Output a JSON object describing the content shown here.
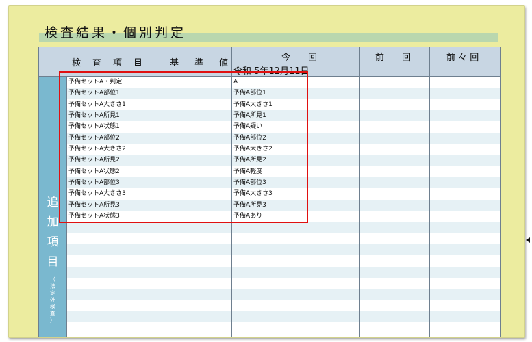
{
  "page": {
    "title": "検査結果・個別判定",
    "side_label_main": [
      "追",
      "加",
      "項",
      "目"
    ],
    "side_label_sub": [
      "（",
      "法",
      "定",
      "外",
      "検",
      "査",
      "）"
    ]
  },
  "table": {
    "headers": {
      "item": "検　査　項　目",
      "standard": [
        "基",
        "準",
        "値"
      ],
      "current": "今　　回",
      "current_date": "令和 5年12月11日",
      "previous": "前　　回",
      "previous2": "前 々 回"
    },
    "rows": [
      {
        "item": "予備セットA・判定",
        "current": "A"
      },
      {
        "item": "予備セットA部位1",
        "current": "予備A部位1"
      },
      {
        "item": "予備セットA大きさ1",
        "current": "予備A大きさ1"
      },
      {
        "item": "予備セットA所見1",
        "current": "予備A所見1"
      },
      {
        "item": "予備セットA状態1",
        "current": "予備A疑い"
      },
      {
        "item": "予備セットA部位2",
        "current": "予備A部位2"
      },
      {
        "item": "予備セットA大きさ2",
        "current": "予備A大きさ2"
      },
      {
        "item": "予備セットA所見2",
        "current": "予備A所見2"
      },
      {
        "item": "予備セットA状態2",
        "current": "予備A軽度"
      },
      {
        "item": "予備セットA部位3",
        "current": "予備A部位3"
      },
      {
        "item": "予備セットA大きさ3",
        "current": "予備A大きさ3"
      },
      {
        "item": "予備セットA所見3",
        "current": "予備A所見3"
      },
      {
        "item": "予備セットA状態3",
        "current": "予備Aあり"
      }
    ]
  },
  "colors": {
    "paper": "#ecec9f",
    "header": "#c8d6e3",
    "side": "#7ab8cf",
    "highlight": "#e01010"
  },
  "icons": {
    "left_marker": "triangle-right-icon",
    "right_marker": "triangle-left-icon"
  }
}
